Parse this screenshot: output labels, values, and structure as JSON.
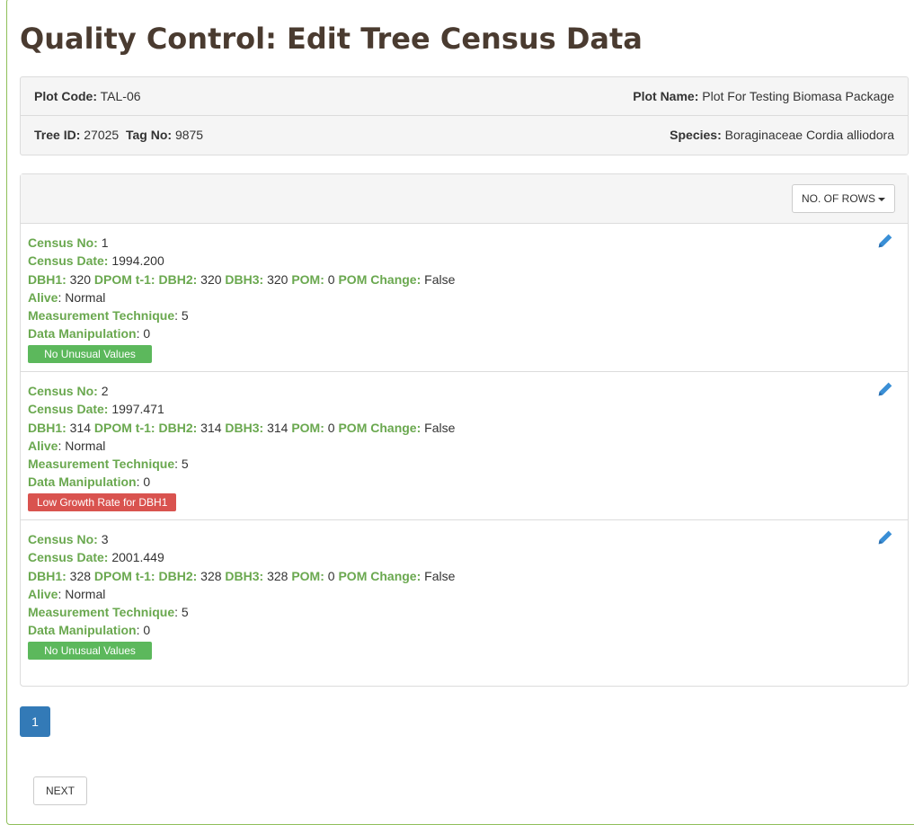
{
  "top_snippet": {
    "pre": "",
    "link": "",
    "post": ""
  },
  "page": {
    "title": "Quality Control: Edit Tree Census Data"
  },
  "info": {
    "plot_code_label": "Plot Code:",
    "plot_code": "TAL-06",
    "plot_name_label": "Plot Name:",
    "plot_name": "Plot For Testing Biomasa Package",
    "tree_id_label": "Tree ID:",
    "tree_id": "27025",
    "tag_no_label": "Tag No:",
    "tag_no": "9875",
    "species_label": "Species:",
    "species": "Boraginaceae Cordia alliodora"
  },
  "panel": {
    "rows_button": "NO. OF ROWS"
  },
  "labels": {
    "census_no": "Census No:",
    "census_date": "Census Date:",
    "dbh1": "DBH1:",
    "dpom": "DPOM t-1:",
    "dbh2": "DBH2:",
    "dbh3": "DBH3:",
    "pom": "POM:",
    "pom_change": "POM Change:",
    "alive": "Alive",
    "measurement_technique": "Measurement Technique",
    "data_manipulation": "Data Manipulation"
  },
  "records": [
    {
      "census_no": "1",
      "census_date": "1994.200",
      "dbh1": "320",
      "dpom": "",
      "dbh2": "320",
      "dbh3": "320",
      "pom": "0",
      "pom_change": "False",
      "alive": ": Normal",
      "measurement_technique": ": 5",
      "data_manipulation": ": 0",
      "badge": "No Unusual Values",
      "badge_status": "ok"
    },
    {
      "census_no": "2",
      "census_date": "1997.471",
      "dbh1": "314",
      "dpom": "",
      "dbh2": "314",
      "dbh3": "314",
      "pom": "0",
      "pom_change": "False",
      "alive": ": Normal",
      "measurement_technique": ": 5",
      "data_manipulation": ": 0",
      "badge": "Low Growth Rate for DBH1",
      "badge_status": "bad"
    },
    {
      "census_no": "3",
      "census_date": "2001.449",
      "dbh1": "328",
      "dpom": "",
      "dbh2": "328",
      "dbh3": "328",
      "pom": "0",
      "pom_change": "False",
      "alive": ": Normal",
      "measurement_technique": ": 5",
      "data_manipulation": ": 0",
      "badge": "No Unusual Values",
      "badge_status": "ok"
    }
  ],
  "pagination": {
    "current_page": "1",
    "next_label": "NEXT"
  },
  "colors": {
    "label_green": "#6aa84f",
    "badge_ok": "#5cb85c",
    "badge_bad": "#d9534f",
    "page_active": "#337ab7",
    "edit_icon": "#3a8fd6"
  },
  "icons": {
    "edit": "pencil-icon",
    "rows_dropdown": "caret-down-icon"
  }
}
